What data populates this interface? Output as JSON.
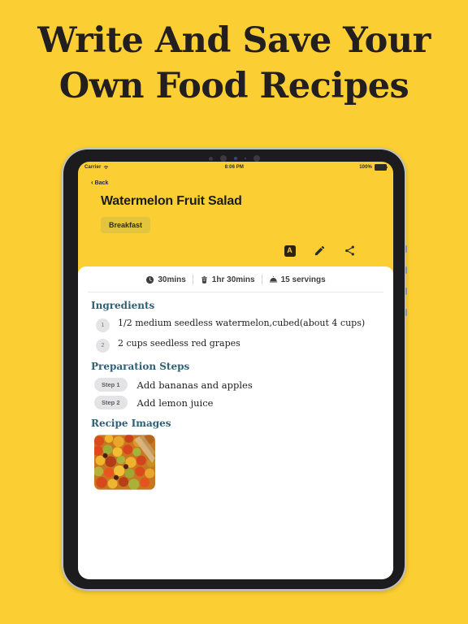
{
  "promo": {
    "headline_line1": "Write And Save Your",
    "headline_line2": "Own Food Recipes",
    "background_color": "#fbcf33",
    "text_color": "#231f20"
  },
  "device": {
    "type": "tablet",
    "sensor_dots": [
      "camera-dot",
      "camera-dot",
      "sensor-dot-blue",
      "sensor-dot-small",
      "camera-dot"
    ]
  },
  "statusbar": {
    "carrier": "Carrier",
    "wifi_icon": "wifi-icon",
    "time": "8:06 PM",
    "battery_percent": "100%",
    "battery_icon": "battery-full-icon"
  },
  "app": {
    "back_label": "Back",
    "back_chevron": "‹",
    "title": "Watermelon Fruit Salad",
    "category_badge": "Breakfast",
    "category_badge_color": "#e3c43f",
    "actions": [
      {
        "name": "font-size-button",
        "label": "A"
      },
      {
        "name": "edit-button",
        "label": ""
      },
      {
        "name": "share-button",
        "label": ""
      }
    ],
    "meta": [
      {
        "icon": "clock-icon",
        "value": "30mins"
      },
      {
        "icon": "cooking-pot-icon",
        "value": "1hr 30mins"
      },
      {
        "icon": "serving-dome-icon",
        "value": "15 servings"
      }
    ],
    "sections": {
      "ingredients_title": "Ingredients",
      "ingredients": [
        {
          "number": "1",
          "text": "1/2 medium seedless watermelon,cubed(about 4 cups)"
        },
        {
          "number": "2",
          "text": "2 cups seedless red grapes"
        }
      ],
      "preparation_title": "Preparation Steps",
      "steps": [
        {
          "label": "Step 1",
          "text": "Add bananas and apples"
        },
        {
          "label": "Step 2",
          "text": "Add lemon juice"
        }
      ],
      "images_title": "Recipe Images",
      "images": [
        {
          "name": "recipe-photo-fruit-salad",
          "alt": "colorful chopped fruit salad"
        }
      ]
    },
    "accent_heading_color": "#2f6076"
  }
}
